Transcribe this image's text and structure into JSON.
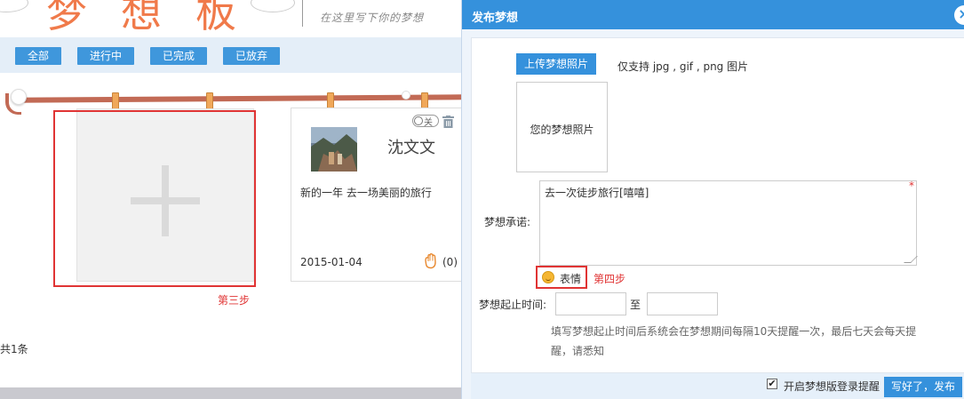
{
  "header": {
    "logo_text": "梦想板",
    "slogan": "在这里写下你的梦想"
  },
  "tabs": [
    {
      "label": "全部"
    },
    {
      "label": "进行中"
    },
    {
      "label": "已完成"
    },
    {
      "label": "已放弃"
    }
  ],
  "board": {
    "step3_label": "第三步",
    "total_label": "共1条"
  },
  "dream_card": {
    "toggle_label": "关",
    "author": "沈文文",
    "description": "新的一年 去一场美丽的旅行",
    "date": "2015-01-04",
    "cheer_count": "(0)"
  },
  "panel": {
    "title": "发布梦想",
    "close_symbol": "×",
    "upload_button": "上传梦想照片",
    "upload_hint": "仅支持 jpg , gif , png 图片",
    "photo_placeholder": "您的梦想照片",
    "promise_label": "梦想承诺:",
    "promise_value": "去一次徒步旅行[嘻嘻]",
    "required_mark": "*",
    "emoji_label": "表情",
    "step4_label": "第四步",
    "time_label": "梦想起止时间:",
    "to_label": "至",
    "time_hint": "填写梦想起止时间后系统会在梦想期间每隔10天提醒一次，最后七天会每天提醒，请悉知",
    "reminder_checked": true,
    "reminder_label": "开启梦想版登录提醒",
    "publish_button": "写好了，发布"
  },
  "colors": {
    "accent_blue": "#3591dc",
    "highlight_red": "#e03434",
    "logo_orange": "#f07a4a",
    "rope": "#c26a55",
    "clip": "#f0a85a"
  }
}
